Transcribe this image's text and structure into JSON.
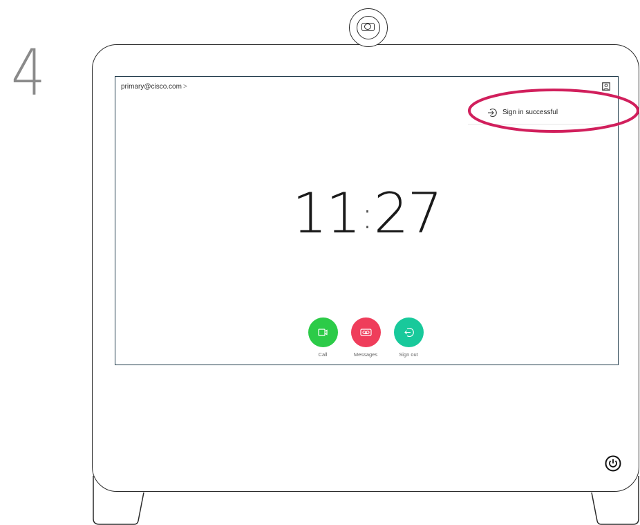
{
  "step": {
    "number": "4"
  },
  "screen": {
    "account_email": "primary@cisco.com",
    "account_chevron": ">",
    "notification": {
      "text": "Sign in successful",
      "icon": "sign-in-icon"
    },
    "clock": {
      "hours": "11",
      "separator": ":",
      "minutes": "27"
    },
    "actions": [
      {
        "label": "Call",
        "icon": "video-camera-icon",
        "color": "#2ccb48"
      },
      {
        "label": "Messages",
        "icon": "voicemail-icon",
        "color": "#ef3d5b"
      },
      {
        "label": "Sign out",
        "icon": "sign-out-icon",
        "color": "#18c99b"
      }
    ]
  },
  "colors": {
    "highlight": "#d11f5c",
    "frame": "#2a2a2a",
    "screen_border": "#1f3a4a"
  }
}
